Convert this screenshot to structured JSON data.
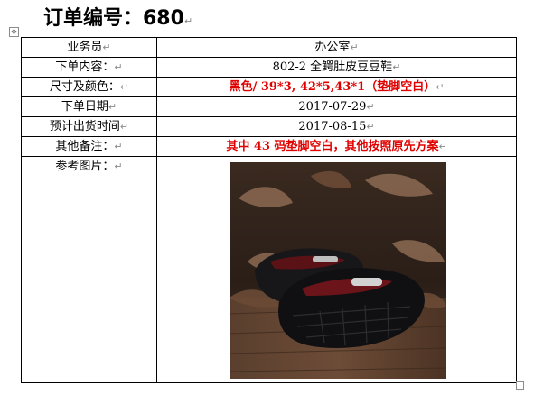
{
  "header": {
    "title": "订单编号：680",
    "para_mark": "↵"
  },
  "rows": [
    {
      "label": "业务员",
      "value": "办公室",
      "value_style": "normal"
    },
    {
      "label": "下单内容：",
      "value": "802-2 全鳄肚皮豆豆鞋",
      "value_style": "normal"
    },
    {
      "label": "尺寸及颜色：",
      "value": "黑色/ 39*3,  42*5,43*1（垫脚空白）",
      "value_style": "red"
    },
    {
      "label": "下单日期",
      "value": "2017-07-29",
      "value_style": "normal"
    },
    {
      "label": "预计出货时间",
      "value": "2017-08-15",
      "value_style": "normal"
    },
    {
      "label": "其他备注：",
      "value": "其中 43 码垫脚空白，其他按照原先方案",
      "value_style": "red"
    },
    {
      "label": "参考图片：",
      "value": "",
      "value_style": "image"
    }
  ],
  "marks": {
    "cell_end": "↵",
    "move_handle": "✥"
  },
  "image": {
    "subject": "black crocodile leather loafers on wooden floor",
    "accent_colors": [
      "#1a1a1d",
      "#5a3b2a",
      "#8c6a52",
      "#b22222"
    ]
  },
  "colors": {
    "red_text": "#e00000",
    "border": "#000000"
  }
}
